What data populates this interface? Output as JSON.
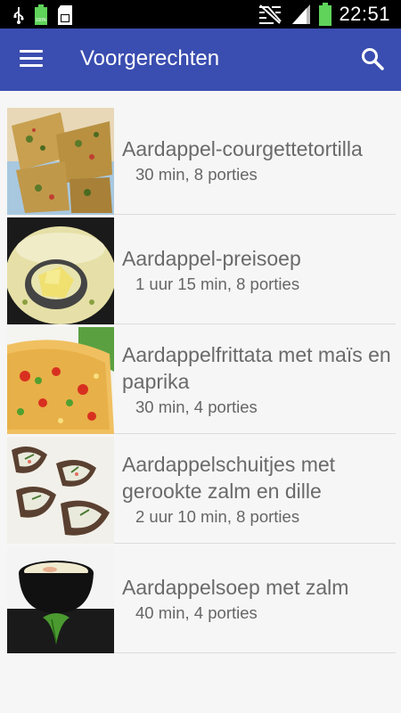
{
  "status_bar": {
    "time": "22:51",
    "battery_small": "100%",
    "icons": [
      "usb-icon",
      "battery-small-icon",
      "sd-card-icon",
      "mute-icon",
      "signal-icon",
      "battery-icon"
    ]
  },
  "app_bar": {
    "title": "Voorgerechten",
    "menu_icon": "menu-icon",
    "search_icon": "search-icon",
    "color": "#3a4db0"
  },
  "recipes": [
    {
      "name": "Aardappel-courgettetortilla",
      "meta": "30 min, 8 porties"
    },
    {
      "name": "Aardappel-preisoep",
      "meta": "1 uur 15 min, 8 porties"
    },
    {
      "name": "Aardappelfrittata met maïs en paprika",
      "meta": "30 min, 4 porties"
    },
    {
      "name": "Aardappelschuitjes met gerookte zalm en dille",
      "meta": "2 uur 10 min, 8 porties"
    },
    {
      "name": "Aardappelsoep met zalm",
      "meta": "40 min, 4 porties"
    }
  ]
}
